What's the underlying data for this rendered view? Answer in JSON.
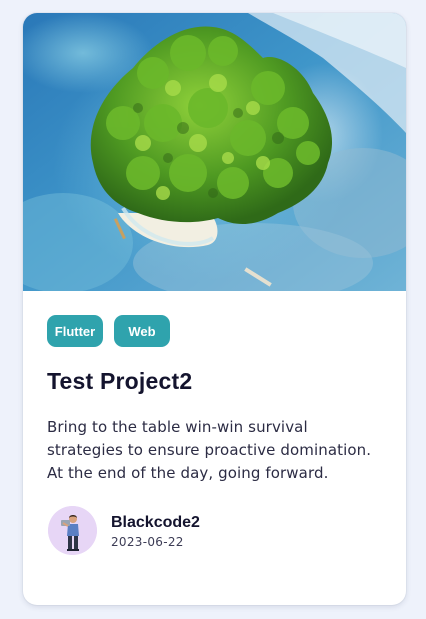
{
  "card": {
    "image_alt": "Aerial view of a tropical island",
    "tags": [
      {
        "label": "Flutter"
      },
      {
        "label": "Web"
      }
    ],
    "title": "Test Project2",
    "description": "Bring to the table win-win survival strategies to ensure proactive domination. At the end of the day, going forward.",
    "author": {
      "name": "Blackcode2",
      "date": "2023-06-22"
    }
  },
  "colors": {
    "tag_background": "#2fa3ad",
    "page_background": "#eef2fb",
    "title": "#14142e",
    "avatar_background": "#e7d6f6"
  }
}
